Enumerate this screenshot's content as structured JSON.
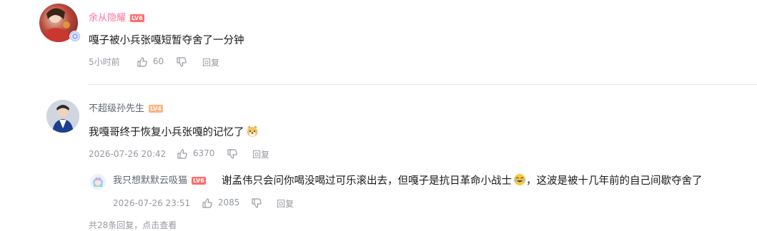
{
  "comments": [
    {
      "username": "余从隐耀",
      "level": "LV6",
      "text": "嘎子被小兵张嘎短暂夺舍了一分钟",
      "time": "5小时前",
      "likes": "60",
      "reply_label": "回复"
    },
    {
      "username": "不超级孙先生",
      "level": "LV4",
      "text": "我嘎哥终于恢复小兵张嘎的记忆了",
      "time": "2026-07-26 20:42",
      "likes": "6370",
      "reply_label": "回复",
      "replies": [
        {
          "username": "我只想默默云吸猫",
          "level": "LV6",
          "text_before": "谢孟伟只会问你喝没喝过可乐滚出去，但嘎子是抗日革命小战士",
          "text_after": "，这波是被十几年前的自己间歇夺舍了",
          "time": "2026-07-26 23:51",
          "likes": "2085",
          "reply_label": "回复"
        }
      ],
      "more_replies": "共28条回复，点击查看"
    }
  ],
  "colors": {
    "vip_name": "#fb7299",
    "name": "#61666d",
    "meta": "#9499a0",
    "lv6": "#ff6b6b",
    "lv4": "#ffb27f"
  }
}
